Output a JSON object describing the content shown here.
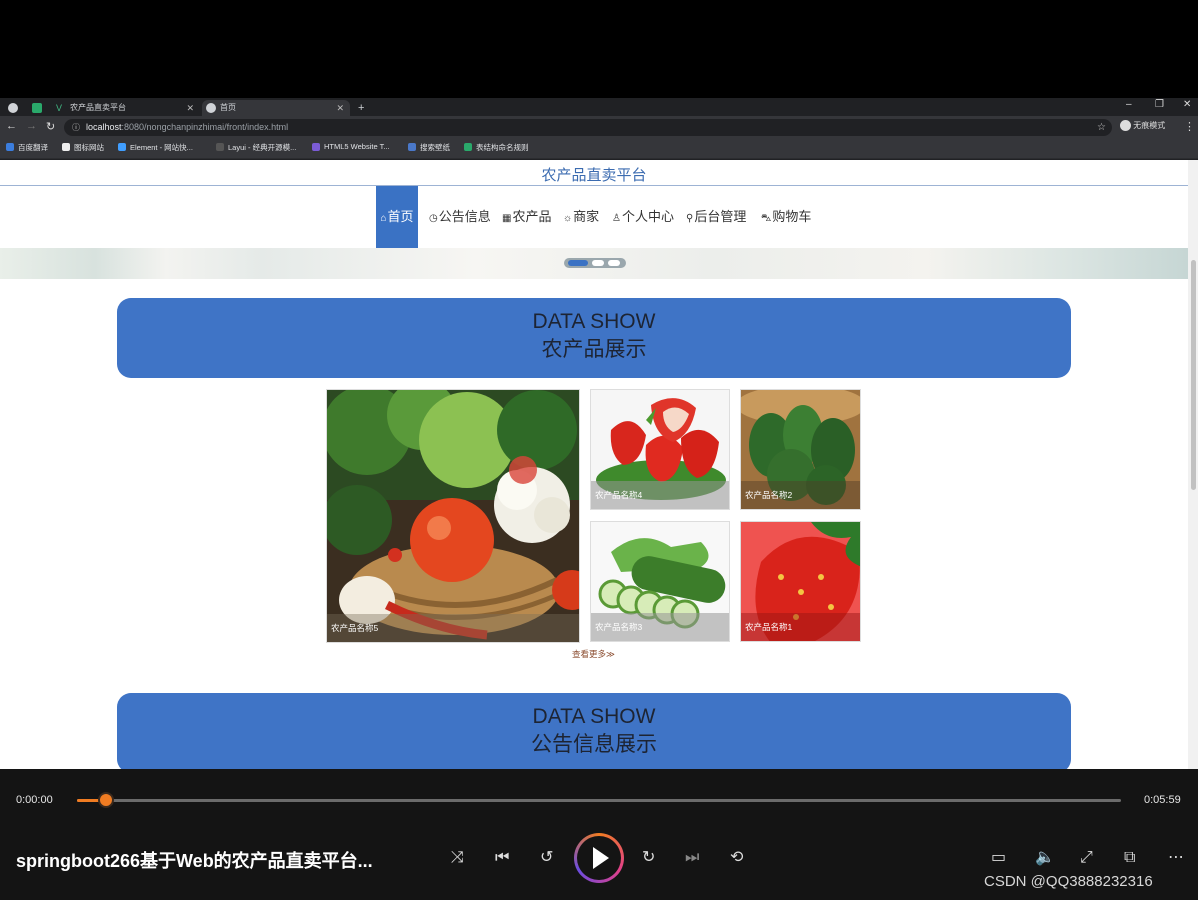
{
  "browser": {
    "tabs": [
      {
        "label": "",
        "active": false
      },
      {
        "label": "农产品直卖平台",
        "active": false
      },
      {
        "label": "首页",
        "active": true
      }
    ],
    "new_tab": "+",
    "url_host": "localhost",
    "url_rest": ":8080/nongchanpinzhimai/front/index.html",
    "profile_label": "无痕模式",
    "bookmarks": [
      "百度翻译",
      "图标网站",
      "Element - 网站快...",
      "Layui - 经典开源模...",
      "HTML5 Website T...",
      "搜索壁纸",
      "表结构命名规则"
    ]
  },
  "site": {
    "title": "农产品直卖平台",
    "nav": [
      {
        "icon": "⌂",
        "label": "首页",
        "active": true
      },
      {
        "icon": "◷",
        "label": "公告信息",
        "active": false
      },
      {
        "icon": "▦",
        "label": "农产品",
        "active": false
      },
      {
        "icon": "☼",
        "label": "商家",
        "active": false
      },
      {
        "icon": "♙",
        "label": "个人中心",
        "active": false
      },
      {
        "icon": "⚲",
        "label": "后台管理",
        "active": false
      },
      {
        "icon": "⛍",
        "label": "购物车",
        "active": false
      }
    ],
    "carousel_dots": 3,
    "carousel_active": 0,
    "section1": {
      "en": "DATA SHOW",
      "cn": "农产品展示"
    },
    "products": [
      {
        "name": "农产品名称5",
        "image": "vegetable-basket"
      },
      {
        "name": "农产品名称4",
        "image": "strawberries"
      },
      {
        "name": "农产品名称2",
        "image": "spinach"
      },
      {
        "name": "农产品名称3",
        "image": "cucumbers"
      },
      {
        "name": "农产品名称1",
        "image": "strawberry-closeup"
      }
    ],
    "more_link": "查看更多≫",
    "section2": {
      "en": "DATA SHOW",
      "cn": "公告信息展示"
    },
    "colors": {
      "accent": "#3f74c6",
      "title": "#3b6bb0"
    }
  },
  "player": {
    "current_time": "0:00:00",
    "total_time": "0:05:59",
    "progress_fraction": 0.03,
    "video_title": "springboot266基于Web的农产品直卖平台...",
    "watermark": "CSDN @QQ3888232316"
  }
}
